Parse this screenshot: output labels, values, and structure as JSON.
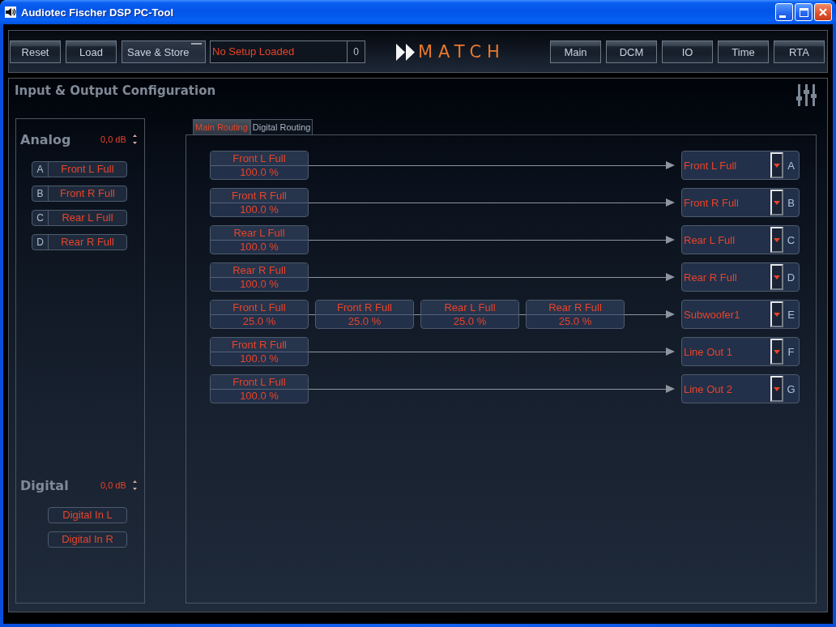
{
  "window": {
    "title": "Audiotec Fischer DSP PC-Tool"
  },
  "toolbar": {
    "buttons": [
      {
        "label": "Reset",
        "kind": "plain"
      },
      {
        "label": "Load",
        "kind": "plain"
      },
      {
        "label": "Save & Store",
        "kind": "indicator"
      }
    ],
    "setup_status": {
      "text": "No Setup Loaded",
      "count": "0"
    },
    "logo": "MATCH",
    "nav_buttons": [
      {
        "label": "Main"
      },
      {
        "label": "DCM"
      },
      {
        "label": "IO"
      },
      {
        "label": "Time"
      },
      {
        "label": "RTA"
      }
    ]
  },
  "panel": {
    "title": "Input & Output Configuration"
  },
  "inputs": {
    "groups": [
      {
        "title": "Analog",
        "gain": "0,0 dB",
        "channels": [
          {
            "letter": "A",
            "name": "Front L Full"
          },
          {
            "letter": "B",
            "name": "Front R Full"
          },
          {
            "letter": "C",
            "name": "Rear L Full"
          },
          {
            "letter": "D",
            "name": "Rear R Full"
          }
        ]
      },
      {
        "title": "Digital",
        "gain": "0,0 dB",
        "channels": [
          {
            "name": "Digital In L"
          },
          {
            "name": "Digital In R"
          }
        ]
      }
    ]
  },
  "routing": {
    "tabs": [
      {
        "label": "Main Routing",
        "selected": true
      },
      {
        "label": "Digital Routing",
        "selected": false
      }
    ],
    "rows": [
      {
        "sources": [
          {
            "name": "Front L Full",
            "share": "100.0 %"
          }
        ],
        "output": {
          "name": "Front L Full",
          "letter": "A"
        }
      },
      {
        "sources": [
          {
            "name": "Front R Full",
            "share": "100.0 %"
          }
        ],
        "output": {
          "name": "Front R Full",
          "letter": "B"
        }
      },
      {
        "sources": [
          {
            "name": "Rear L Full",
            "share": "100.0 %"
          }
        ],
        "output": {
          "name": "Rear L Full",
          "letter": "C"
        }
      },
      {
        "sources": [
          {
            "name": "Rear R Full",
            "share": "100.0 %"
          }
        ],
        "output": {
          "name": "Rear R Full",
          "letter": "D"
        }
      },
      {
        "sources": [
          {
            "name": "Front L Full",
            "share": "25.0 %"
          },
          {
            "name": "Front R Full",
            "share": "25.0 %"
          },
          {
            "name": "Rear L Full",
            "share": "25.0 %"
          },
          {
            "name": "Rear R Full",
            "share": "25.0 %"
          }
        ],
        "output": {
          "name": "Subwoofer1",
          "letter": "E"
        }
      },
      {
        "sources": [
          {
            "name": "Front R Full",
            "share": "100.0 %"
          }
        ],
        "output": {
          "name": "Line Out 1",
          "letter": "F"
        }
      },
      {
        "sources": [
          {
            "name": "Front L Full",
            "share": "100.0 %"
          }
        ],
        "output": {
          "name": "Line Out 2",
          "letter": "G"
        }
      }
    ]
  }
}
